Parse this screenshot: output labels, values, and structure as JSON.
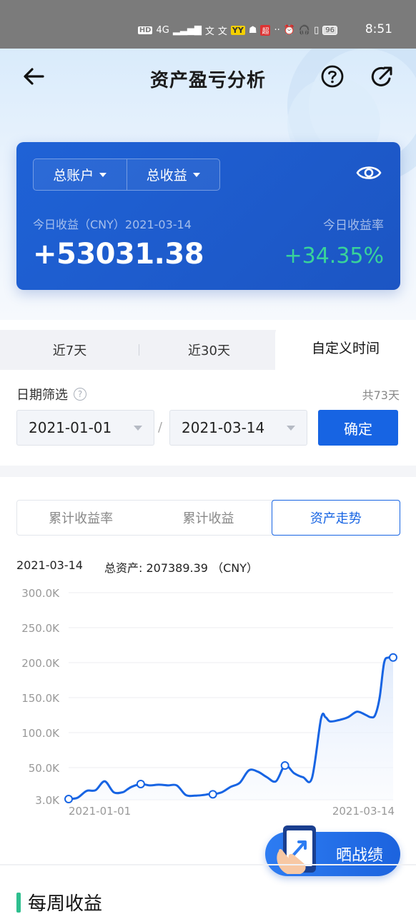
{
  "status_bar": {
    "time": "8:51",
    "battery": "96",
    "network": "4G",
    "hd": "HD"
  },
  "header": {
    "title": "资产盈亏分析",
    "back_icon": "arrow-left-icon",
    "help_icon": "question-circle-icon",
    "share_icon": "share-icon"
  },
  "account_card": {
    "account_selector": "总账户",
    "metric_selector": "总收益",
    "today_label": "今日收益（CNY）2021-03-14",
    "today_rate_label": "今日收益率",
    "today_amount": "+53031.38",
    "today_rate": "+34.35%",
    "colors": {
      "card": "#1f62d6",
      "positive": "#38d39a"
    }
  },
  "period_tabs": [
    {
      "label": "近7天",
      "active": false
    },
    {
      "label": "近30天",
      "active": false
    },
    {
      "label": "自定义时间",
      "active": true
    }
  ],
  "date_filter": {
    "label": "日期筛选",
    "total_days": "共73天",
    "start_date": "2021-01-01",
    "separator": "/",
    "end_date": "2021-03-14",
    "confirm": "确定"
  },
  "chart_tabs": [
    {
      "label": "累计收益率",
      "active": false
    },
    {
      "label": "累计收益",
      "active": false
    },
    {
      "label": "资产走势",
      "active": true
    }
  ],
  "chart_info": {
    "date": "2021-03-14",
    "total_assets": "总资产: 207389.39 （CNY）"
  },
  "chart_data": {
    "type": "area",
    "y_ticks": [
      "300.0K",
      "250.0K",
      "200.0K",
      "150.0K",
      "100.0K",
      "50.0K",
      "3.0K"
    ],
    "x_labels": [
      "2021-01-01",
      "2021-03-14"
    ],
    "ylim": [
      3000,
      300000
    ],
    "series": [
      {
        "x": [
          0,
          2,
          4,
          6,
          8,
          10,
          12,
          13,
          14,
          16,
          18,
          20,
          22,
          24,
          26,
          28,
          30,
          31,
          32,
          34,
          36,
          38,
          40,
          42,
          44,
          46,
          48,
          50,
          52,
          54,
          56,
          57,
          58,
          60,
          62,
          64,
          66,
          67,
          68,
          69,
          70,
          71,
          72
        ],
        "values": [
          4000,
          6000,
          16000,
          17000,
          30000,
          14000,
          14000,
          18000,
          22000,
          26000,
          24000,
          25000,
          24000,
          24000,
          10000,
          9000,
          10000,
          11000,
          11000,
          14000,
          22000,
          28000,
          46000,
          44000,
          36000,
          30000,
          53000,
          42000,
          36000,
          35000,
          120000,
          122000,
          116000,
          118000,
          122000,
          130000,
          125000,
          122000,
          125000,
          150000,
          200000,
          207389,
          207389
        ]
      }
    ],
    "markers_x": [
      0,
      16,
      32,
      48,
      72
    ],
    "colors": {
      "line": "#1764e3",
      "area_top": "#eaf1fd"
    }
  },
  "share_button": {
    "label": "晒战绩"
  },
  "weekly_section": {
    "title": "每周收益"
  }
}
